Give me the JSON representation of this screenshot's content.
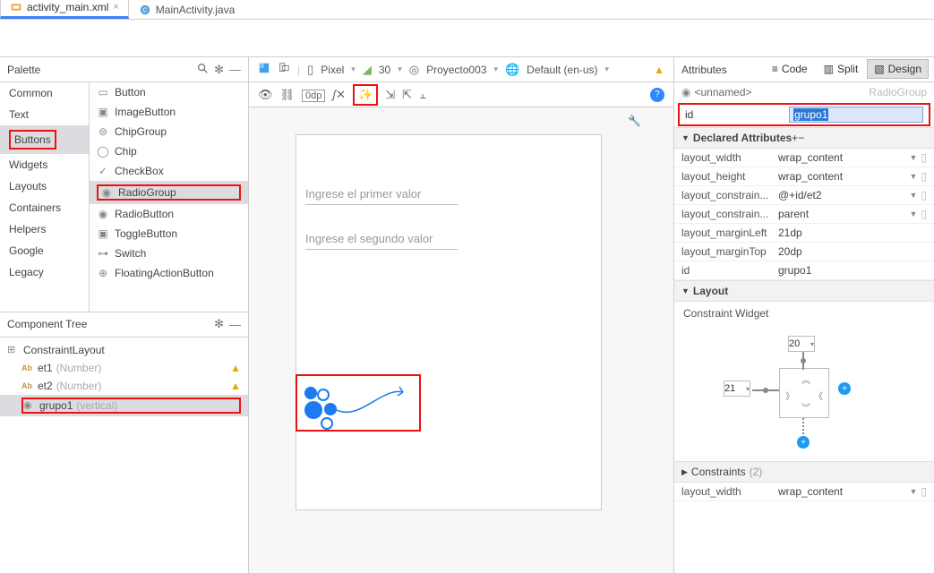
{
  "tabs": [
    {
      "label": "activity_main.xml",
      "active": true
    },
    {
      "label": "MainActivity.java",
      "active": false
    }
  ],
  "view_modes": {
    "code": "Code",
    "split": "Split",
    "design": "Design",
    "active": "design"
  },
  "palette": {
    "title": "Palette",
    "categories": [
      "Common",
      "Text",
      "Buttons",
      "Widgets",
      "Layouts",
      "Containers",
      "Helpers",
      "Google",
      "Legacy"
    ],
    "selected_category": "Buttons",
    "items": [
      {
        "label": "Button",
        "icon": "button"
      },
      {
        "label": "ImageButton",
        "icon": "image"
      },
      {
        "label": "ChipGroup",
        "icon": "chips"
      },
      {
        "label": "Chip",
        "icon": "chip"
      },
      {
        "label": "CheckBox",
        "icon": "check"
      },
      {
        "label": "RadioGroup",
        "icon": "radio",
        "selected": true
      },
      {
        "label": "RadioButton",
        "icon": "radio"
      },
      {
        "label": "ToggleButton",
        "icon": "toggle"
      },
      {
        "label": "Switch",
        "icon": "switch"
      },
      {
        "label": "FloatingActionButton",
        "icon": "fab"
      }
    ]
  },
  "component_tree": {
    "title": "Component Tree",
    "root": {
      "label": "ConstraintLayout",
      "icon": "layout"
    },
    "children": [
      {
        "label": "et1",
        "hint": "(Number)",
        "warn": true,
        "icon": "ab"
      },
      {
        "label": "et2",
        "hint": "(Number)",
        "warn": true,
        "icon": "ab"
      },
      {
        "label": "grupo1",
        "hint": "(vertical)",
        "selected": true,
        "icon": "radio"
      }
    ]
  },
  "design_toolbar": {
    "device": "Pixel",
    "api": "30",
    "theme": "Proyecto003",
    "locale": "Default (en-us)"
  },
  "margins_value": "0dp",
  "preview": {
    "et1_hint": "Ingrese el primer valor",
    "et2_hint": "Ingrese el segundo valor"
  },
  "attributes": {
    "title": "Attributes",
    "unnamed": "<unnamed>",
    "class": "RadioGroup",
    "id_label": "id",
    "id_value": "grupo1",
    "declared_title": "Declared Attributes",
    "rows": [
      {
        "key": "layout_width",
        "value": "wrap_content",
        "drop": true
      },
      {
        "key": "layout_height",
        "value": "wrap_content",
        "drop": true
      },
      {
        "key": "layout_constrain...",
        "value": "@+id/et2",
        "drop": true
      },
      {
        "key": "layout_constrain...",
        "value": "parent",
        "drop": true
      },
      {
        "key": "layout_marginLeft",
        "value": "21dp"
      },
      {
        "key": "layout_marginTop",
        "value": "20dp"
      },
      {
        "key": "id",
        "value": "grupo1"
      }
    ],
    "layout_title": "Layout",
    "constraint_widget_title": "Constraint Widget",
    "cw_top": "20",
    "cw_left": "21",
    "constraints_title": "Constraints",
    "constraints_count": "(2)",
    "repeat_layout_width_key": "layout_width",
    "repeat_layout_width_val": "wrap_content"
  }
}
